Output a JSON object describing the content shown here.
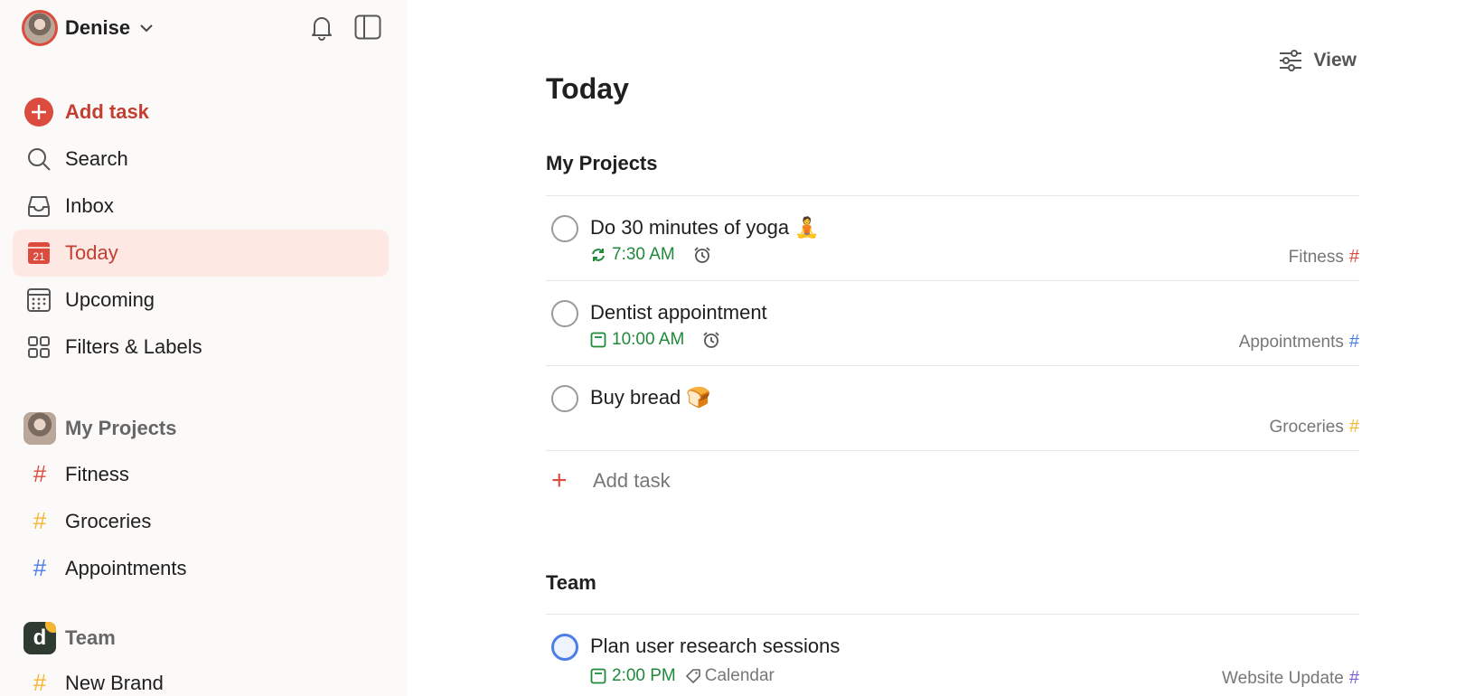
{
  "user": {
    "name": "Denise"
  },
  "nav": {
    "add_task": "Add task",
    "search": "Search",
    "inbox": "Inbox",
    "today": "Today",
    "today_day": "21",
    "upcoming": "Upcoming",
    "filters": "Filters & Labels"
  },
  "sidebar": {
    "my_projects": "My Projects",
    "projects": [
      {
        "label": "Fitness",
        "color": "#dc4c3e"
      },
      {
        "label": "Groceries",
        "color": "#f5b731"
      },
      {
        "label": "Appointments",
        "color": "#4c7ee8"
      }
    ],
    "team": "Team",
    "team_initial": "d",
    "team_projects": [
      {
        "label": "New Brand",
        "color": "#f5b731"
      }
    ]
  },
  "main": {
    "view_label": "View",
    "title": "Today",
    "sections": [
      {
        "title": "My Projects",
        "tasks": [
          {
            "title": "Do 30 minutes of yoga 🧘",
            "time": "7:30 AM",
            "project": "Fitness",
            "project_color": "#dc4c3e",
            "recurring": true,
            "alarm": true
          },
          {
            "title": "Dentist appointment",
            "time": "10:00 AM",
            "project": "Appointments",
            "project_color": "#4c7ee8",
            "recurring": false,
            "alarm": true
          },
          {
            "title": "Buy bread 🍞",
            "time": "",
            "project": "Groceries",
            "project_color": "#f5b731"
          }
        ],
        "add_task": "Add task"
      },
      {
        "title": "Team",
        "tasks": [
          {
            "title": "Plan user research sessions",
            "time": "2:00 PM",
            "label": "Calendar",
            "project": "Website Update",
            "project_color": "#7b61d9"
          }
        ]
      }
    ]
  },
  "colors": {
    "accent": "#dc4c3e",
    "today_bg": "#fde8e3",
    "time_green": "#1f8a3a"
  }
}
